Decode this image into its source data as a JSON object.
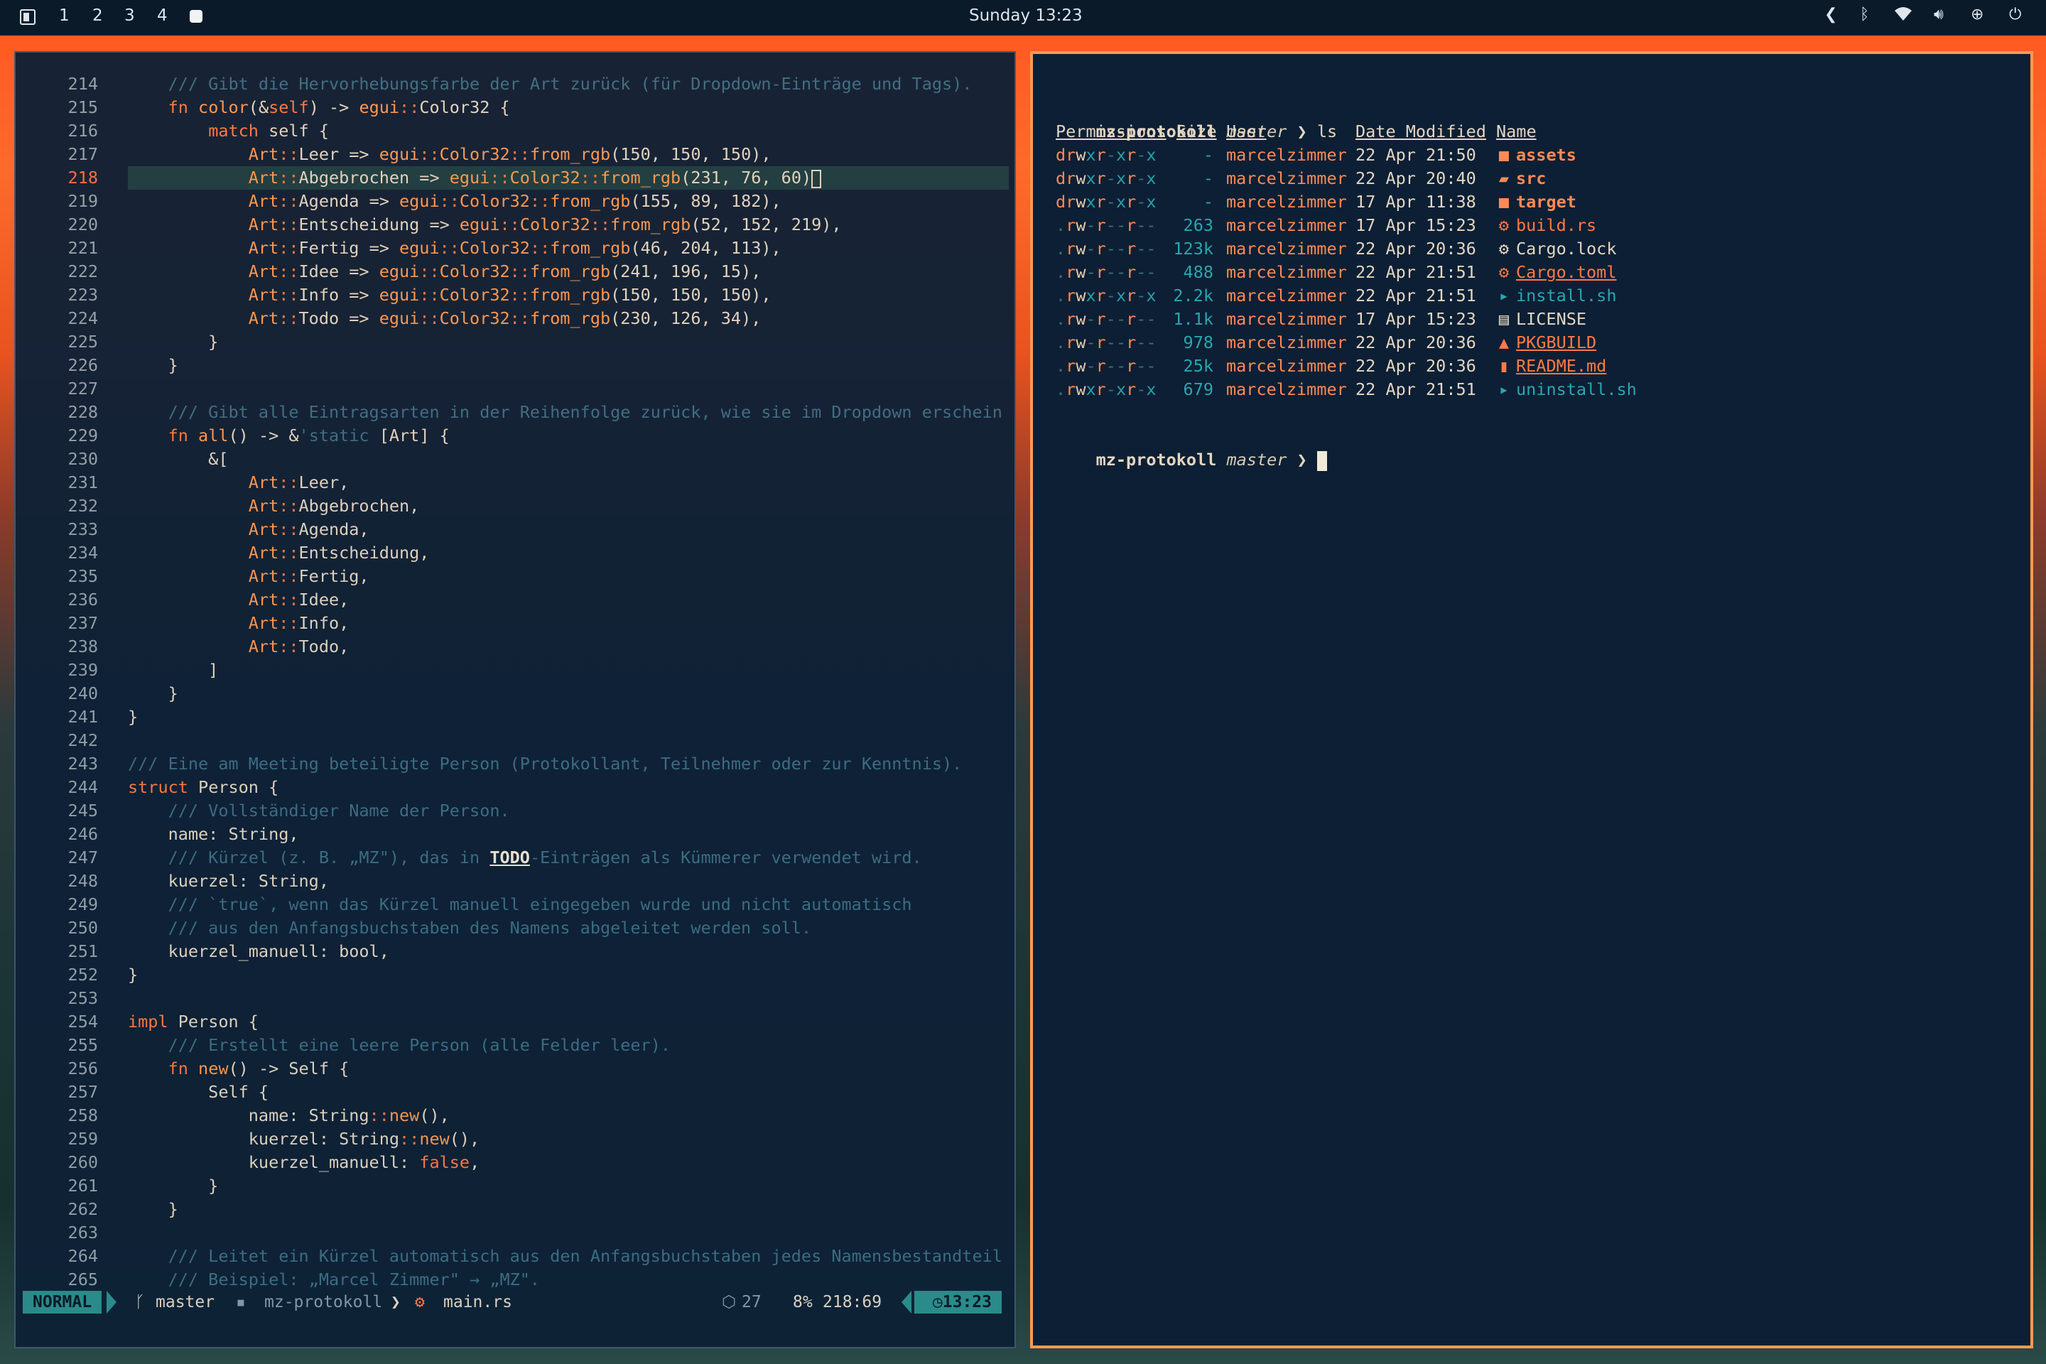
{
  "topbar": {
    "workspaces": [
      "1",
      "2",
      "3",
      "4"
    ],
    "clock": "Sunday 13:23"
  },
  "editor": {
    "lines": [
      {
        "n": "214",
        "tokens": [
          [
            "    ",
            "nm"
          ],
          [
            "/// Gibt die Hervorhebungsfarbe der Art zurück (für Dropdown-Einträge und Tags).",
            "cm"
          ]
        ]
      },
      {
        "n": "215",
        "tokens": [
          [
            "    ",
            "nm"
          ],
          [
            "fn ",
            "kw"
          ],
          [
            "color",
            "ty"
          ],
          [
            "(&",
            "nm"
          ],
          [
            "self",
            "kw"
          ],
          [
            ") -> ",
            "nm"
          ],
          [
            "egui",
            "ty"
          ],
          [
            "::",
            "kw"
          ],
          [
            "Color32 {",
            "nm"
          ]
        ]
      },
      {
        "n": "216",
        "tokens": [
          [
            "        ",
            "nm"
          ],
          [
            "match ",
            "kw"
          ],
          [
            "self",
            "nm"
          ],
          [
            " {",
            "nm"
          ]
        ]
      },
      {
        "n": "217",
        "tokens": [
          [
            "            ",
            "nm"
          ],
          [
            "Art",
            "ty"
          ],
          [
            "::",
            "kw"
          ],
          [
            "Leer => ",
            "nm"
          ],
          [
            "egui",
            "ty"
          ],
          [
            "::",
            "kw"
          ],
          [
            "Color32",
            "ty"
          ],
          [
            "::",
            "kw"
          ],
          [
            "from_rgb",
            "ty"
          ],
          [
            "(150, 150, 150),",
            "nm"
          ]
        ]
      },
      {
        "n": "218",
        "current": true,
        "tokens": [
          [
            "            ",
            "nm"
          ],
          [
            "Art",
            "ty"
          ],
          [
            "::",
            "kw"
          ],
          [
            "Abgebrochen => ",
            "nm"
          ],
          [
            "egui",
            "ty"
          ],
          [
            "::",
            "kw"
          ],
          [
            "Color32",
            "ty"
          ],
          [
            "::",
            "kw"
          ],
          [
            "from_rgb",
            "ty"
          ],
          [
            "(231, 76, 60)",
            "nm"
          ]
        ]
      },
      {
        "n": "219",
        "tokens": [
          [
            "            ",
            "nm"
          ],
          [
            "Art",
            "ty"
          ],
          [
            "::",
            "kw"
          ],
          [
            "Agenda => ",
            "nm"
          ],
          [
            "egui",
            "ty"
          ],
          [
            "::",
            "kw"
          ],
          [
            "Color32",
            "ty"
          ],
          [
            "::",
            "kw"
          ],
          [
            "from_rgb",
            "ty"
          ],
          [
            "(155, 89, 182),",
            "nm"
          ]
        ]
      },
      {
        "n": "220",
        "tokens": [
          [
            "            ",
            "nm"
          ],
          [
            "Art",
            "ty"
          ],
          [
            "::",
            "kw"
          ],
          [
            "Entscheidung => ",
            "nm"
          ],
          [
            "egui",
            "ty"
          ],
          [
            "::",
            "kw"
          ],
          [
            "Color32",
            "ty"
          ],
          [
            "::",
            "kw"
          ],
          [
            "from_rgb",
            "ty"
          ],
          [
            "(52, 152, 219),",
            "nm"
          ]
        ]
      },
      {
        "n": "221",
        "tokens": [
          [
            "            ",
            "nm"
          ],
          [
            "Art",
            "ty"
          ],
          [
            "::",
            "kw"
          ],
          [
            "Fertig => ",
            "nm"
          ],
          [
            "egui",
            "ty"
          ],
          [
            "::",
            "kw"
          ],
          [
            "Color32",
            "ty"
          ],
          [
            "::",
            "kw"
          ],
          [
            "from_rgb",
            "ty"
          ],
          [
            "(46, 204, 113),",
            "nm"
          ]
        ]
      },
      {
        "n": "222",
        "tokens": [
          [
            "            ",
            "nm"
          ],
          [
            "Art",
            "ty"
          ],
          [
            "::",
            "kw"
          ],
          [
            "Idee => ",
            "nm"
          ],
          [
            "egui",
            "ty"
          ],
          [
            "::",
            "kw"
          ],
          [
            "Color32",
            "ty"
          ],
          [
            "::",
            "kw"
          ],
          [
            "from_rgb",
            "ty"
          ],
          [
            "(241, 196, 15),",
            "nm"
          ]
        ]
      },
      {
        "n": "223",
        "tokens": [
          [
            "            ",
            "nm"
          ],
          [
            "Art",
            "ty"
          ],
          [
            "::",
            "kw"
          ],
          [
            "Info => ",
            "nm"
          ],
          [
            "egui",
            "ty"
          ],
          [
            "::",
            "kw"
          ],
          [
            "Color32",
            "ty"
          ],
          [
            "::",
            "kw"
          ],
          [
            "from_rgb",
            "ty"
          ],
          [
            "(150, 150, 150),",
            "nm"
          ]
        ]
      },
      {
        "n": "224",
        "tokens": [
          [
            "            ",
            "nm"
          ],
          [
            "Art",
            "ty"
          ],
          [
            "::",
            "kw"
          ],
          [
            "Todo => ",
            "nm"
          ],
          [
            "egui",
            "ty"
          ],
          [
            "::",
            "kw"
          ],
          [
            "Color32",
            "ty"
          ],
          [
            "::",
            "kw"
          ],
          [
            "from_rgb",
            "ty"
          ],
          [
            "(230, 126, 34),",
            "nm"
          ]
        ]
      },
      {
        "n": "225",
        "tokens": [
          [
            "        }",
            "nm"
          ]
        ]
      },
      {
        "n": "226",
        "tokens": [
          [
            "    }",
            "nm"
          ]
        ]
      },
      {
        "n": "227",
        "tokens": []
      },
      {
        "n": "228",
        "tokens": [
          [
            "    ",
            "nm"
          ],
          [
            "/// Gibt alle Eintragsarten in der Reihenfolge zurück, wie sie im Dropdown erschein",
            "cm"
          ]
        ]
      },
      {
        "n": "229",
        "tokens": [
          [
            "    ",
            "nm"
          ],
          [
            "fn ",
            "kw"
          ],
          [
            "all",
            "ty"
          ],
          [
            "() -> &",
            "nm"
          ],
          [
            "'static",
            "cm"
          ],
          [
            " [Art] {",
            "nm"
          ]
        ]
      },
      {
        "n": "230",
        "tokens": [
          [
            "        &[",
            "nm"
          ]
        ]
      },
      {
        "n": "231",
        "tokens": [
          [
            "            ",
            "nm"
          ],
          [
            "Art",
            "ty"
          ],
          [
            "::",
            "kw"
          ],
          [
            "Leer,",
            "nm"
          ]
        ]
      },
      {
        "n": "232",
        "tokens": [
          [
            "            ",
            "nm"
          ],
          [
            "Art",
            "ty"
          ],
          [
            "::",
            "kw"
          ],
          [
            "Abgebrochen,",
            "nm"
          ]
        ]
      },
      {
        "n": "233",
        "tokens": [
          [
            "            ",
            "nm"
          ],
          [
            "Art",
            "ty"
          ],
          [
            "::",
            "kw"
          ],
          [
            "Agenda,",
            "nm"
          ]
        ]
      },
      {
        "n": "234",
        "tokens": [
          [
            "            ",
            "nm"
          ],
          [
            "Art",
            "ty"
          ],
          [
            "::",
            "kw"
          ],
          [
            "Entscheidung,",
            "nm"
          ]
        ]
      },
      {
        "n": "235",
        "tokens": [
          [
            "            ",
            "nm"
          ],
          [
            "Art",
            "ty"
          ],
          [
            "::",
            "kw"
          ],
          [
            "Fertig,",
            "nm"
          ]
        ]
      },
      {
        "n": "236",
        "tokens": [
          [
            "            ",
            "nm"
          ],
          [
            "Art",
            "ty"
          ],
          [
            "::",
            "kw"
          ],
          [
            "Idee,",
            "nm"
          ]
        ]
      },
      {
        "n": "237",
        "tokens": [
          [
            "            ",
            "nm"
          ],
          [
            "Art",
            "ty"
          ],
          [
            "::",
            "kw"
          ],
          [
            "Info,",
            "nm"
          ]
        ]
      },
      {
        "n": "238",
        "tokens": [
          [
            "            ",
            "nm"
          ],
          [
            "Art",
            "ty"
          ],
          [
            "::",
            "kw"
          ],
          [
            "Todo,",
            "nm"
          ]
        ]
      },
      {
        "n": "239",
        "tokens": [
          [
            "        ]",
            "nm"
          ]
        ]
      },
      {
        "n": "240",
        "tokens": [
          [
            "    }",
            "nm"
          ]
        ]
      },
      {
        "n": "241",
        "tokens": [
          [
            "}",
            "nm"
          ]
        ]
      },
      {
        "n": "242",
        "tokens": []
      },
      {
        "n": "243",
        "tokens": [
          [
            "/// Eine am Meeting beteiligte Person (Protokollant, Teilnehmer oder zur Kenntnis).",
            "cm"
          ]
        ]
      },
      {
        "n": "244",
        "tokens": [
          [
            "struct ",
            "kw"
          ],
          [
            "Person {",
            "nm"
          ]
        ]
      },
      {
        "n": "245",
        "tokens": [
          [
            "    ",
            "nm"
          ],
          [
            "/// Vollständiger Name der Person.",
            "cm"
          ]
        ]
      },
      {
        "n": "246",
        "tokens": [
          [
            "    name: ",
            "nm"
          ],
          [
            "String",
            "nm"
          ],
          [
            ",",
            "nm"
          ]
        ]
      },
      {
        "n": "247",
        "tokens": [
          [
            "    ",
            "nm"
          ],
          [
            "/// Kürzel (z. B. „MZ\"), das in ",
            "cm"
          ],
          [
            "TODO",
            "todo"
          ],
          [
            "-Einträgen als Kümmerer verwendet wird.",
            "cm"
          ]
        ]
      },
      {
        "n": "248",
        "tokens": [
          [
            "    kuerzel: String,",
            "nm"
          ]
        ]
      },
      {
        "n": "249",
        "tokens": [
          [
            "    ",
            "nm"
          ],
          [
            "/// `true`, wenn das Kürzel manuell eingegeben wurde und nicht automatisch",
            "cm"
          ]
        ]
      },
      {
        "n": "250",
        "tokens": [
          [
            "    ",
            "nm"
          ],
          [
            "/// aus den Anfangsbuchstaben des Namens abgeleitet werden soll.",
            "cm"
          ]
        ]
      },
      {
        "n": "251",
        "tokens": [
          [
            "    kuerzel_manuell: bool,",
            "nm"
          ]
        ]
      },
      {
        "n": "252",
        "tokens": [
          [
            "}",
            "nm"
          ]
        ]
      },
      {
        "n": "253",
        "tokens": []
      },
      {
        "n": "254",
        "tokens": [
          [
            "impl ",
            "kw"
          ],
          [
            "Person {",
            "nm"
          ]
        ]
      },
      {
        "n": "255",
        "tokens": [
          [
            "    ",
            "nm"
          ],
          [
            "/// Erstellt eine leere Person (alle Felder leer).",
            "cm"
          ]
        ]
      },
      {
        "n": "256",
        "tokens": [
          [
            "    ",
            "nm"
          ],
          [
            "fn ",
            "kw"
          ],
          [
            "new",
            "ty"
          ],
          [
            "() -> Self {",
            "nm"
          ]
        ]
      },
      {
        "n": "257",
        "tokens": [
          [
            "        Self {",
            "nm"
          ]
        ]
      },
      {
        "n": "258",
        "tokens": [
          [
            "            name: String",
            "nm"
          ],
          [
            "::",
            "kw"
          ],
          [
            "new",
            "ty"
          ],
          [
            "(),",
            "nm"
          ]
        ]
      },
      {
        "n": "259",
        "tokens": [
          [
            "            kuerzel: String",
            "nm"
          ],
          [
            "::",
            "kw"
          ],
          [
            "new",
            "ty"
          ],
          [
            "(),",
            "nm"
          ]
        ]
      },
      {
        "n": "260",
        "tokens": [
          [
            "            kuerzel_manuell: ",
            "nm"
          ],
          [
            "false",
            "vl"
          ],
          [
            ",",
            "nm"
          ]
        ]
      },
      {
        "n": "261",
        "tokens": [
          [
            "        }",
            "nm"
          ]
        ]
      },
      {
        "n": "262",
        "tokens": [
          [
            "    }",
            "nm"
          ]
        ]
      },
      {
        "n": "263",
        "tokens": []
      },
      {
        "n": "264",
        "tokens": [
          [
            "    ",
            "nm"
          ],
          [
            "/// Leitet ein Kürzel automatisch aus den Anfangsbuchstaben jedes Namensbestandteil",
            "cm"
          ]
        ]
      },
      {
        "n": "265",
        "tokens": [
          [
            "    ",
            "nm"
          ],
          [
            "/// Beispiel: „Marcel Zimmer\" → „MZ\".",
            "cm"
          ]
        ]
      }
    ],
    "statusline": {
      "mode": "NORMAL",
      "branch": "master",
      "project": "mz-protokoll",
      "file": "main.rs",
      "diagnostics": "27",
      "progress": "8%",
      "position": "218:69",
      "time": "13:23"
    }
  },
  "terminal": {
    "prompt_path": "mz-protokoll",
    "prompt_branch": "master",
    "prompt_symbol": "❯",
    "command": "ls",
    "headers": {
      "permissions": "Permissions",
      "size": "Size",
      "user": "User",
      "date": "Date Modified",
      "name": "Name"
    },
    "rows": [
      {
        "perm": "drwxr-xr-x",
        "size": "-",
        "user": "marcelzimmer",
        "date": "22 Apr 21:50",
        "icon": "■",
        "name": "assets",
        "kind": "dir"
      },
      {
        "perm": "drwxr-xr-x",
        "size": "-",
        "user": "marcelzimmer",
        "date": "22 Apr 20:40",
        "icon": "▰",
        "name": "src",
        "kind": "dir"
      },
      {
        "perm": "drwxr-xr-x",
        "size": "-",
        "user": "marcelzimmer",
        "date": "17 Apr 11:38",
        "icon": "■",
        "name": "target",
        "kind": "dir"
      },
      {
        "perm": ".rw-r--r--",
        "size": "263",
        "user": "marcelzimmer",
        "date": "17 Apr 15:23",
        "icon": "⚙",
        "name": "build.rs",
        "kind": "rs"
      },
      {
        "perm": ".rw-r--r--",
        "size": "123k",
        "user": "marcelzimmer",
        "date": "22 Apr 20:36",
        "icon": "⚙",
        "name": "Cargo.lock",
        "kind": "plain"
      },
      {
        "perm": ".rw-r--r--",
        "size": "488",
        "user": "marcelzimmer",
        "date": "22 Apr 21:51",
        "icon": "⚙",
        "name": "Cargo.toml",
        "kind": "orange"
      },
      {
        "perm": ".rwxr-xr-x",
        "size": "2.2k",
        "user": "marcelzimmer",
        "date": "22 Apr 21:51",
        "icon": "▸",
        "name": "install.sh",
        "kind": "sh"
      },
      {
        "perm": ".rw-r--r--",
        "size": "1.1k",
        "user": "marcelzimmer",
        "date": "17 Apr 15:23",
        "icon": "▤",
        "name": "LICENSE",
        "kind": "plain"
      },
      {
        "perm": ".rw-r--r--",
        "size": "978",
        "user": "marcelzimmer",
        "date": "22 Apr 20:36",
        "icon": "▲",
        "name": "PKGBUILD",
        "kind": "orange"
      },
      {
        "perm": ".rw-r--r--",
        "size": "25k",
        "user": "marcelzimmer",
        "date": "22 Apr 20:36",
        "icon": "▮",
        "name": "README.md",
        "kind": "orange"
      },
      {
        "perm": ".rwxr-xr-x",
        "size": "679",
        "user": "marcelzimmer",
        "date": "22 Apr 21:51",
        "icon": "▸",
        "name": "uninstall.sh",
        "kind": "sh"
      }
    ]
  }
}
